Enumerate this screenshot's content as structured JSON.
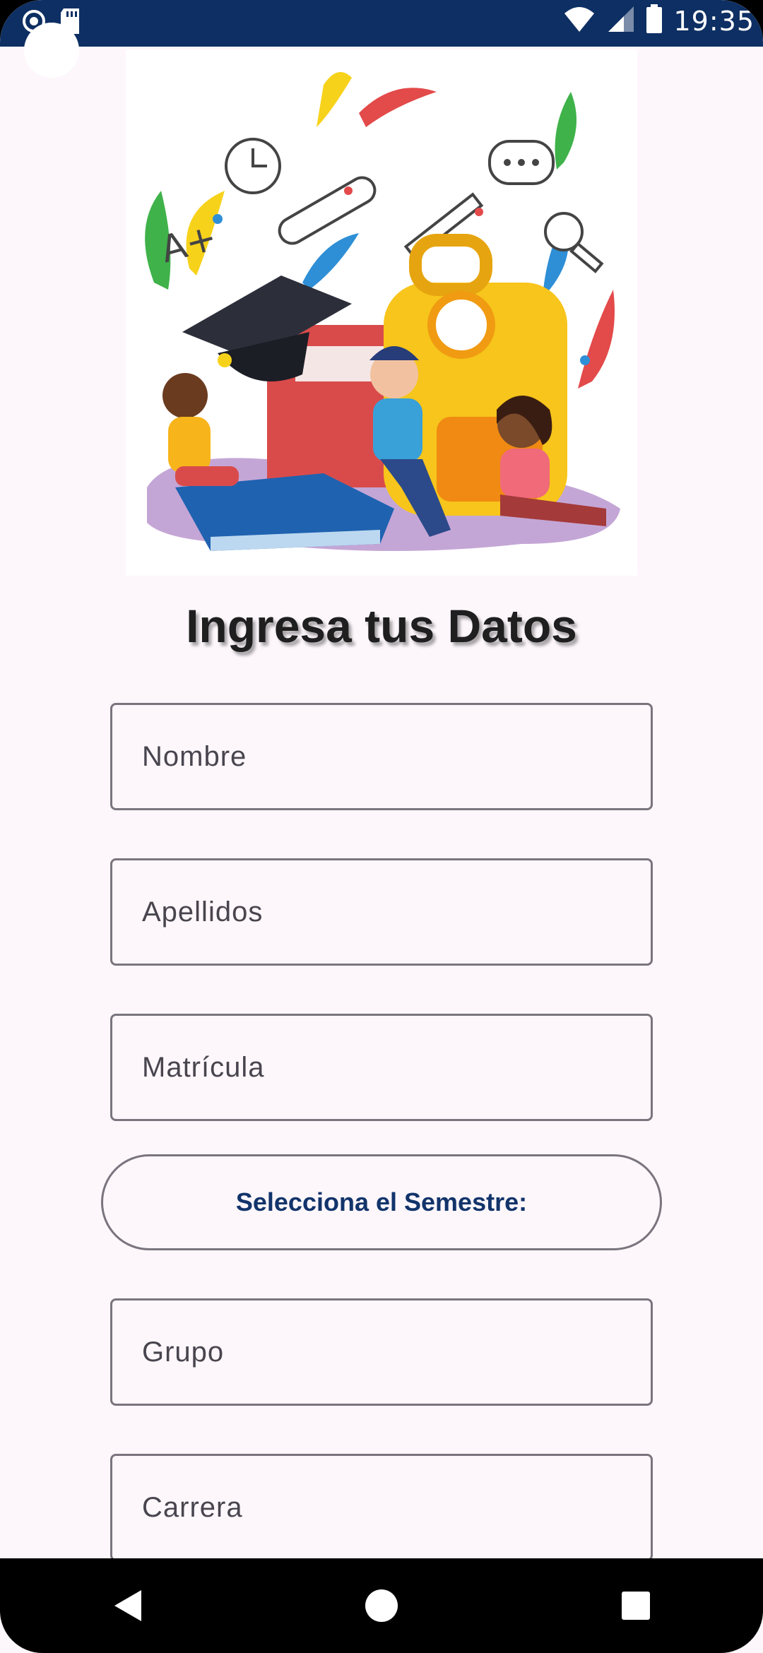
{
  "status_bar": {
    "time": "19:35",
    "icons": [
      "camera-icon",
      "sd-card-icon",
      "wifi-icon",
      "signal-icon",
      "battery-icon"
    ]
  },
  "hero": {
    "image": "students-school-illustration",
    "text": "A+"
  },
  "form": {
    "title": "Ingresa tus Datos",
    "nombre_placeholder": "Nombre",
    "apellidos_placeholder": "Apellidos",
    "matricula_placeholder": "Matrícula",
    "semestre_label": "Selecciona el Semestre:",
    "grupo_placeholder": "Grupo",
    "carrera_placeholder": "Carrera"
  },
  "nav": {
    "buttons": [
      "back-icon",
      "home-icon",
      "recents-icon"
    ]
  },
  "colors": {
    "status_bar": "#0d2f63",
    "background": "#fdf7fb",
    "accent_text": "#12346b",
    "outline": "#79747e"
  }
}
